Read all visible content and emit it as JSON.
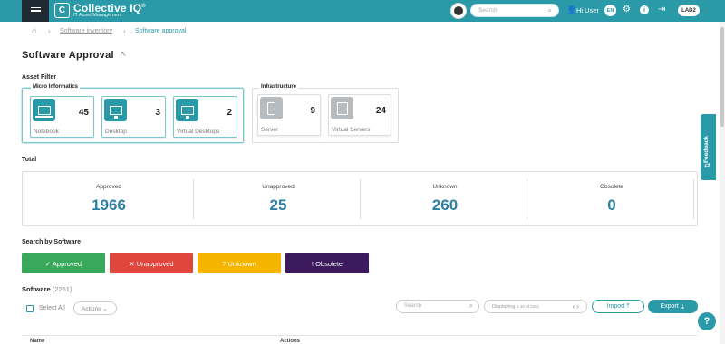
{
  "topbar": {
    "app_name": "Collective IQ",
    "app_trademark": "®",
    "app_subtitle": "IT Asset Management",
    "search_placeholder": "Search",
    "user_label": "Hi User",
    "language": "EN",
    "tenant": "LAD2",
    "icons": [
      "menu-icon",
      "avatar",
      "search-icon",
      "user-icon",
      "gear-icon",
      "info-icon",
      "logout-icon"
    ],
    "accent_color": "#2b9aa8"
  },
  "breadcrumb": {
    "items": [
      "Software inventory",
      "Software approval"
    ]
  },
  "page": {
    "title": "Software Approval"
  },
  "asset_filter": {
    "label": "Asset Filter",
    "groups": [
      {
        "title": "Micro Informatics",
        "cards": [
          {
            "label": "Notebook",
            "count": "45",
            "icon": "laptop-icon"
          },
          {
            "label": "Desktop",
            "count": "3",
            "icon": "monitor-icon"
          },
          {
            "label": "Virtual Desktops",
            "count": "2",
            "icon": "virtual-desktop-icon"
          }
        ]
      },
      {
        "title": "Infrastructure",
        "cards": [
          {
            "label": "Server",
            "count": "9",
            "icon": "server-icon"
          },
          {
            "label": "Virtual Servers",
            "count": "24",
            "icon": "virtual-server-icon"
          }
        ]
      }
    ]
  },
  "totals": {
    "label": "Total",
    "items": [
      {
        "label": "Approved",
        "value": "1966"
      },
      {
        "label": "Unapproved",
        "value": "25"
      },
      {
        "label": "Unknown",
        "value": "260"
      },
      {
        "label": "Obsolete",
        "value": "0"
      }
    ]
  },
  "search_by_software": {
    "label": "Search by Software",
    "buttons": [
      {
        "label": "✓ Approved",
        "color": "#3aa85a"
      },
      {
        "label": "✕ Unapproved",
        "color": "#e0463b"
      },
      {
        "label": "? Unknown",
        "color": "#f5b400"
      },
      {
        "label": "! Obsolete",
        "color": "#3d1a5e"
      }
    ]
  },
  "software": {
    "title": "Software",
    "count": "(2251)",
    "select_all": "Select All",
    "actions": "Actions",
    "search_placeholder": "Search",
    "pager": "Displaying",
    "pager_range": "1-10 of 2251",
    "import_label": "Import",
    "export_label": "Export",
    "columns": [
      "Name",
      "Actions"
    ]
  },
  "feedback": {
    "label": "Feedback"
  },
  "help": {
    "label": "?"
  }
}
